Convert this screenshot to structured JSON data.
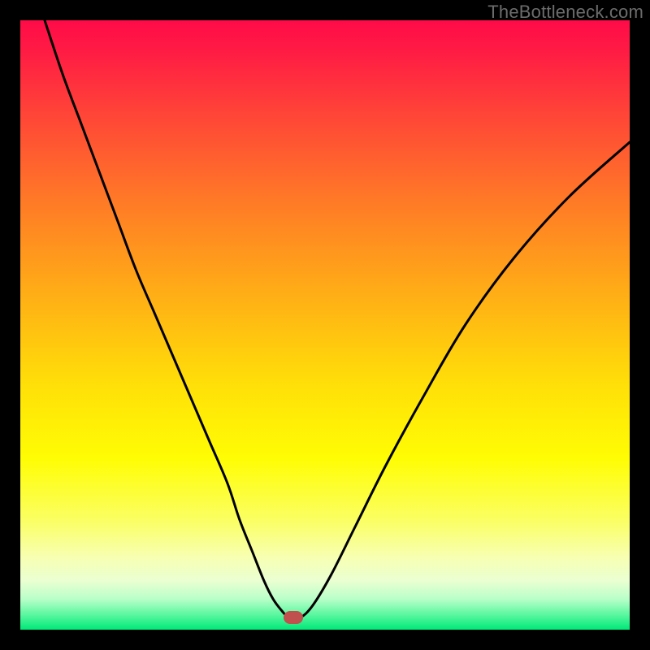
{
  "watermark": {
    "text": "TheBottleneck.com"
  },
  "chart_data": {
    "type": "line",
    "title": "",
    "xlabel": "",
    "ylabel": "",
    "xlim": [
      0,
      100
    ],
    "ylim": [
      0,
      100
    ],
    "background_gradient": {
      "stops": [
        {
          "pos": 0.0,
          "color": "#ff0b48"
        },
        {
          "pos": 0.05,
          "color": "#ff1b44"
        },
        {
          "pos": 0.15,
          "color": "#ff4338"
        },
        {
          "pos": 0.3,
          "color": "#ff7b26"
        },
        {
          "pos": 0.45,
          "color": "#ffae16"
        },
        {
          "pos": 0.6,
          "color": "#ffe008"
        },
        {
          "pos": 0.72,
          "color": "#fffd04"
        },
        {
          "pos": 0.82,
          "color": "#fbff62"
        },
        {
          "pos": 0.88,
          "color": "#f7ffb0"
        },
        {
          "pos": 0.92,
          "color": "#eaffd2"
        },
        {
          "pos": 0.95,
          "color": "#b8ffc8"
        },
        {
          "pos": 0.975,
          "color": "#5cf7a0"
        },
        {
          "pos": 1.0,
          "color": "#00e878"
        }
      ]
    },
    "series": [
      {
        "name": "bottleneck-curve",
        "x": [
          4,
          7,
          10,
          13,
          16,
          19,
          22,
          25,
          28,
          31,
          34,
          36,
          38,
          40,
          41.5,
          43,
          44,
          44.8,
          46,
          48,
          51,
          55,
          60,
          66,
          73,
          81,
          90,
          100
        ],
        "y": [
          100,
          91,
          83,
          75,
          67,
          59,
          52,
          45,
          38,
          31,
          24,
          18,
          13,
          8,
          5,
          3,
          2,
          2,
          2,
          4,
          9,
          17,
          27,
          38,
          50,
          61,
          71,
          80
        ]
      }
    ],
    "marker": {
      "x": 44.8,
      "y": 2,
      "color": "#c0504d"
    }
  }
}
